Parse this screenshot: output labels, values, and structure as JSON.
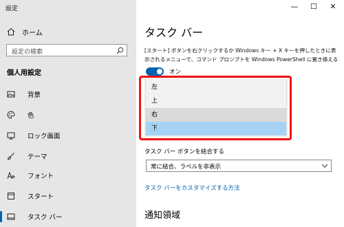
{
  "window": {
    "title": "設定",
    "minimize_glyph": "—",
    "maximize_glyph": "☐",
    "close_glyph": "✕"
  },
  "sidebar": {
    "home_label": "ホーム",
    "search_placeholder": "設定の検索",
    "section_title": "個人用設定",
    "items": [
      {
        "label": "背景",
        "icon": "picture-icon"
      },
      {
        "label": "色",
        "icon": "palette-icon"
      },
      {
        "label": "ロック画面",
        "icon": "lock-screen-icon"
      },
      {
        "label": "テーマ",
        "icon": "brush-icon"
      },
      {
        "label": "フォント",
        "icon": "font-icon"
      },
      {
        "label": "スタート",
        "icon": "start-icon"
      },
      {
        "label": "タスク バー",
        "icon": "taskbar-icon",
        "selected": true
      }
    ]
  },
  "main": {
    "title": "タスク バー",
    "description": "[スタート] ボタンを右クリックするか Windows キー + X キーを押したときに表示されるメニューで、コマンド プロンプトを Windows PowerShell に置き換える",
    "toggle": {
      "state": "オン",
      "on": true
    },
    "position_options": [
      {
        "label": "左"
      },
      {
        "label": "上"
      },
      {
        "label": "右",
        "state": "hover"
      },
      {
        "label": "下",
        "state": "selected"
      }
    ],
    "combine_label": "タスク バー ボタンを結合する",
    "combine_value": "常に結合、ラベルを非表示",
    "customize_link": "タスク バーをカスタマイズする方法",
    "notification_title": "通知領域"
  },
  "colors": {
    "accent": "#0063b1",
    "highlight_border": "#ee1111",
    "list_selected": "#a6d3f5",
    "list_hover": "#dadada",
    "sidebar_bg": "#e6e6e6"
  }
}
